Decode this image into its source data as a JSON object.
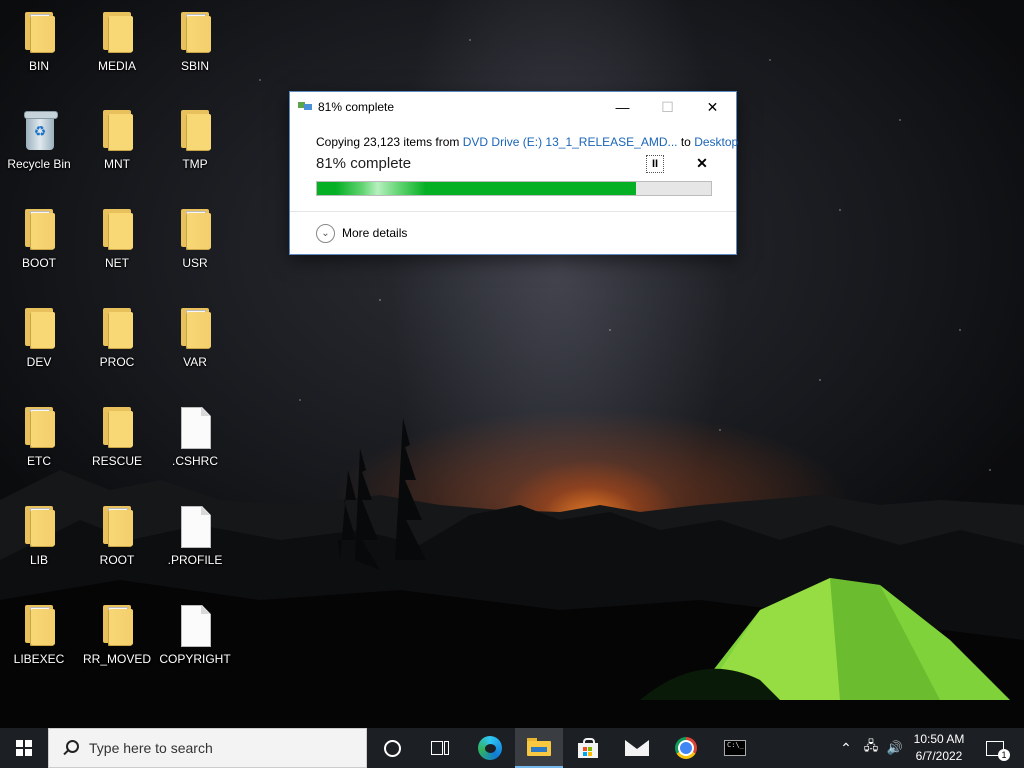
{
  "desktop": {
    "icons": [
      {
        "label": "BIN",
        "type": "folder-docs"
      },
      {
        "label": "MEDIA",
        "type": "folder"
      },
      {
        "label": "SBIN",
        "type": "folder-docs"
      },
      {
        "label": "Recycle Bin",
        "type": "recycle-bin"
      },
      {
        "label": "MNT",
        "type": "folder"
      },
      {
        "label": "TMP",
        "type": "folder"
      },
      {
        "label": "BOOT",
        "type": "folder-docs"
      },
      {
        "label": "NET",
        "type": "folder"
      },
      {
        "label": "USR",
        "type": "folder-docs"
      },
      {
        "label": "DEV",
        "type": "folder"
      },
      {
        "label": "PROC",
        "type": "folder"
      },
      {
        "label": "VAR",
        "type": "folder-docs"
      },
      {
        "label": "ETC",
        "type": "folder-docs"
      },
      {
        "label": "RESCUE",
        "type": "folder"
      },
      {
        "label": ".CSHRC",
        "type": "file"
      },
      {
        "label": "LIB",
        "type": "folder-docs"
      },
      {
        "label": "ROOT",
        "type": "folder-docs"
      },
      {
        "label": ".PROFILE",
        "type": "file"
      },
      {
        "label": "LIBEXEC",
        "type": "folder-docs"
      },
      {
        "label": "RR_MOVED",
        "type": "folder-docs"
      },
      {
        "label": "COPYRIGHT",
        "type": "file"
      }
    ]
  },
  "copy_dialog": {
    "title": "81% complete",
    "copying_prefix": "Copying 23,123 items from ",
    "source": "DVD Drive (E:) 13_1_RELEASE_AMD...",
    "to_word": " to ",
    "destination": "Desktop",
    "status": "81% complete",
    "progress_percent": 81,
    "more_details": "More details",
    "minimize_glyph": "—",
    "maximize_glyph": "☐",
    "close_glyph": "✕",
    "pause_glyph": "II",
    "stop_glyph": "✕",
    "more_glyph": "⌄"
  },
  "taskbar": {
    "search_placeholder": "Type here to search",
    "pinned": [
      "cortana-icon",
      "task-view-icon",
      "edge-icon",
      "file-explorer-icon",
      "store-icon",
      "mail-icon",
      "chrome-icon",
      "command-prompt-icon"
    ],
    "cmd_glyph": "C:\\_",
    "tray": {
      "chevron_glyph": "⌃",
      "network_glyph": "🖧",
      "volume_glyph": "🔊"
    },
    "time": "10:50 AM",
    "date": "6/7/2022",
    "notification_count": "1"
  },
  "colors": {
    "progress_green": "#06b025",
    "link_blue": "#1a65b8",
    "taskbar_bg": "#1c1f24",
    "tent_green": "#7fd23a"
  }
}
